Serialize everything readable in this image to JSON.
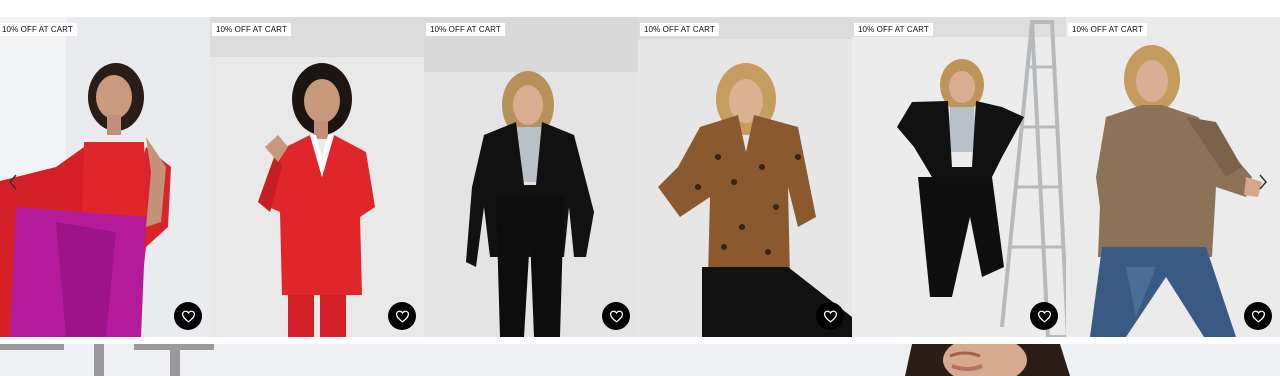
{
  "carousel": {
    "products": [
      {
        "badge": "10% OFF AT CART",
        "wishlist_icon": "heart-outline-icon"
      },
      {
        "badge": "10% OFF AT CART",
        "wishlist_icon": "heart-outline-icon"
      },
      {
        "badge": "10% OFF AT CART",
        "wishlist_icon": "heart-outline-icon"
      },
      {
        "badge": "10% OFF AT CART",
        "wishlist_icon": "heart-outline-icon"
      },
      {
        "badge": "10% OFF AT CART",
        "wishlist_icon": "heart-outline-icon"
      },
      {
        "badge": "10% OFF AT CART",
        "wishlist_icon": "heart-outline-icon"
      }
    ],
    "prev_icon": "chevron-left-icon",
    "next_icon": "chevron-right-icon"
  },
  "colors": {
    "badge_bg": "#ffffff",
    "wishlist_bg": "#000000",
    "wishlist_icon": "#ffffff",
    "red_outfit": "#e0262a",
    "magenta_skirt": "#b31b9b",
    "black_suit": "#111111",
    "leopard": "#8a5a2e",
    "bronze_blouse": "#8c7358",
    "denim": "#3a5a86"
  }
}
